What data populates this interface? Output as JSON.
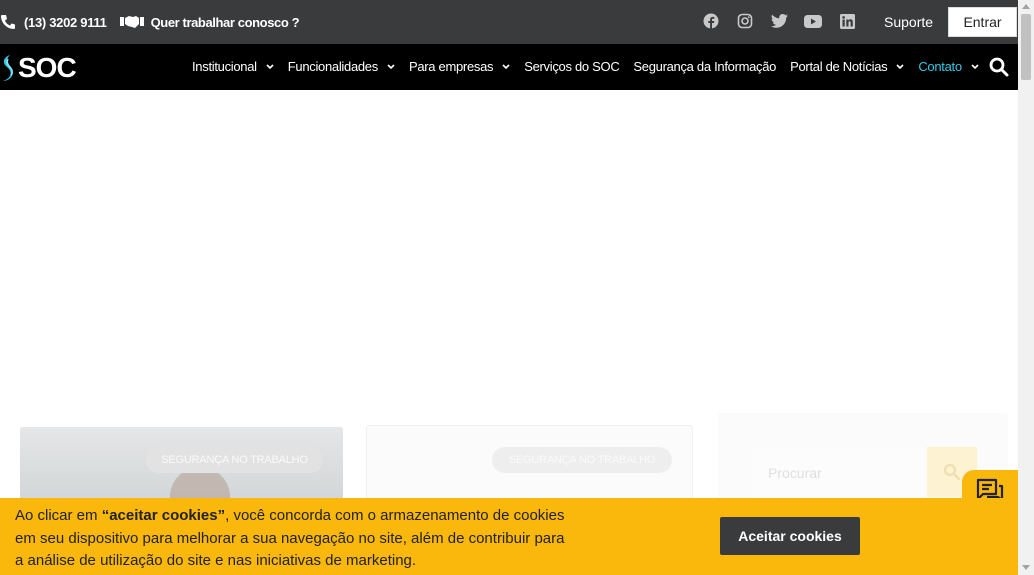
{
  "topbar": {
    "phone": "(13) 3202 9111",
    "work_link": "Quer trabalhar conosco ?",
    "socials": [
      "facebook-icon",
      "instagram-icon",
      "twitter-icon",
      "youtube-icon",
      "linkedin-icon"
    ],
    "suporte": "Suporte",
    "entrar": "Entrar"
  },
  "brand": {
    "logo_text": "SOC"
  },
  "nav": {
    "items": [
      {
        "label": "Institucional",
        "has_dropdown": true
      },
      {
        "label": "Funcionalidades",
        "has_dropdown": true
      },
      {
        "label": "Para empresas",
        "has_dropdown": true
      },
      {
        "label": "Serviços do SOC",
        "has_dropdown": false
      },
      {
        "label": "Segurança da Informação",
        "has_dropdown": false
      },
      {
        "label": "Portal de Notícias",
        "has_dropdown": true
      },
      {
        "label": "Contato",
        "has_dropdown": true,
        "active": true
      }
    ]
  },
  "content": {
    "card1_badge": "SEGURANÇA NO TRABALHO",
    "card2_badge": "SEGURANÇA NO TRABALHO",
    "search_placeholder": "Procurar"
  },
  "cookie": {
    "prefix": "Ao clicar em ",
    "highlight": "“aceitar cookies”",
    "suffix": ", você concorda com o armazenamento de cookies em seu dispositivo para melhorar a sua navegação no site, além de contribuir para a análise de utilização do site e nas iniciativas de marketing.",
    "button": "Aceitar cookies"
  },
  "colors": {
    "topbar_bg": "#3a3b3d",
    "nav_bg": "#000000",
    "accent": "#35c8e8",
    "cookie_bg": "#fab70c"
  }
}
